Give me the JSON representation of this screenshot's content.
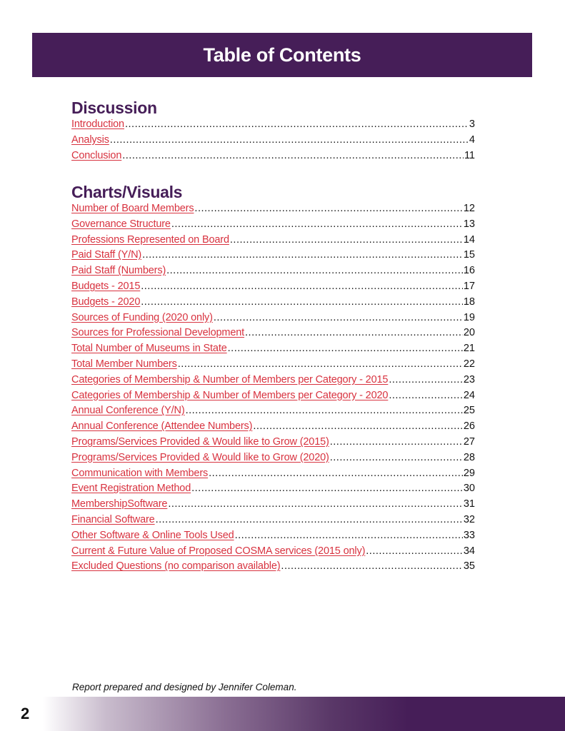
{
  "header": {
    "title": "Table of Contents"
  },
  "colors": {
    "banner": "#461e58",
    "heading": "#461e58",
    "link": "#d8323f",
    "text": "#111111"
  },
  "sections": [
    {
      "heading": "Discussion",
      "items": [
        {
          "label": "Introduction",
          "page": "3"
        },
        {
          "label": "Analysis",
          "page": "4"
        },
        {
          "label": "Conclusion",
          "page": "11"
        }
      ]
    },
    {
      "heading": "Charts/Visuals",
      "items": [
        {
          "label": "Number of Board Members",
          "page": "12"
        },
        {
          "label": "Governance Structure",
          "page": "13"
        },
        {
          "label": "Professions Represented on Board",
          "page": "14"
        },
        {
          "label": "Paid Staff (Y/N)",
          "page": "15"
        },
        {
          "label": "Paid Staff (Numbers)",
          "page": "16"
        },
        {
          "label": "Budgets - 2015",
          "page": "17"
        },
        {
          "label": "Budgets - 2020",
          "page": "18"
        },
        {
          "label": "Sources of Funding (2020 only)",
          "page": "19"
        },
        {
          "label": "Sources for Professional Development",
          "page": "20"
        },
        {
          "label": "Total Number of Museums in State",
          "page": "21"
        },
        {
          "label": "Total Member Numbers",
          "page": "22"
        },
        {
          "label": "Categories of Membership & Number of Members per Category - 2015",
          "page": "23"
        },
        {
          "label": "Categories of Membership & Number of Members per Category - 2020",
          "page": "24"
        },
        {
          "label": "Annual Conference (Y/N)",
          "page": "25"
        },
        {
          "label": "Annual Conference (Attendee Numbers)",
          "page": "26"
        },
        {
          "label": "Programs/Services Provided & Would like to Grow (2015)",
          "page": "27"
        },
        {
          "label": "Programs/Services Provided & Would like to Grow (2020)",
          "page": "28"
        },
        {
          "label": "Communication with Members",
          "page": "29"
        },
        {
          "label": "Event Registration Method",
          "page": "30"
        },
        {
          "label": "MembershipSoftware",
          "page": "31"
        },
        {
          "label": "Financial Software",
          "page": "32"
        },
        {
          "label": "Other Software & Online Tools Used",
          "page": "33"
        },
        {
          "label": "Current & Future Value of Proposed COSMA services (2015 only)",
          "page": "34"
        },
        {
          "label": "Excluded Questions (no comparison available)",
          "page": "35"
        }
      ]
    }
  ],
  "footer": {
    "credit": "Report prepared and designed by Jennifer Coleman.",
    "page_number": "2"
  }
}
